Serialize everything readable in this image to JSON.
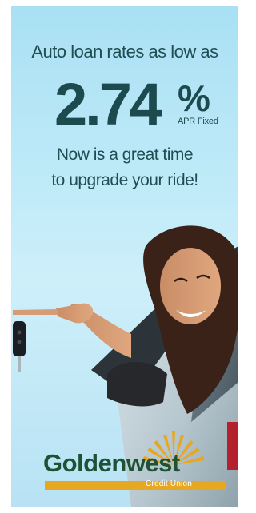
{
  "ad": {
    "headline": "Auto loan rates as low as",
    "rate": "2.74",
    "percent": "%",
    "rate_note": "APR Fixed",
    "tagline_1": "Now is a great time",
    "tagline_2": "to upgrade your ride!",
    "image_alt": "woman-pointing-car-key-from-car-window"
  },
  "logo": {
    "name": "Goldenwest",
    "subtitle": "Credit Union",
    "brand_gold": "#e6a823",
    "brand_green": "#1e5236"
  }
}
